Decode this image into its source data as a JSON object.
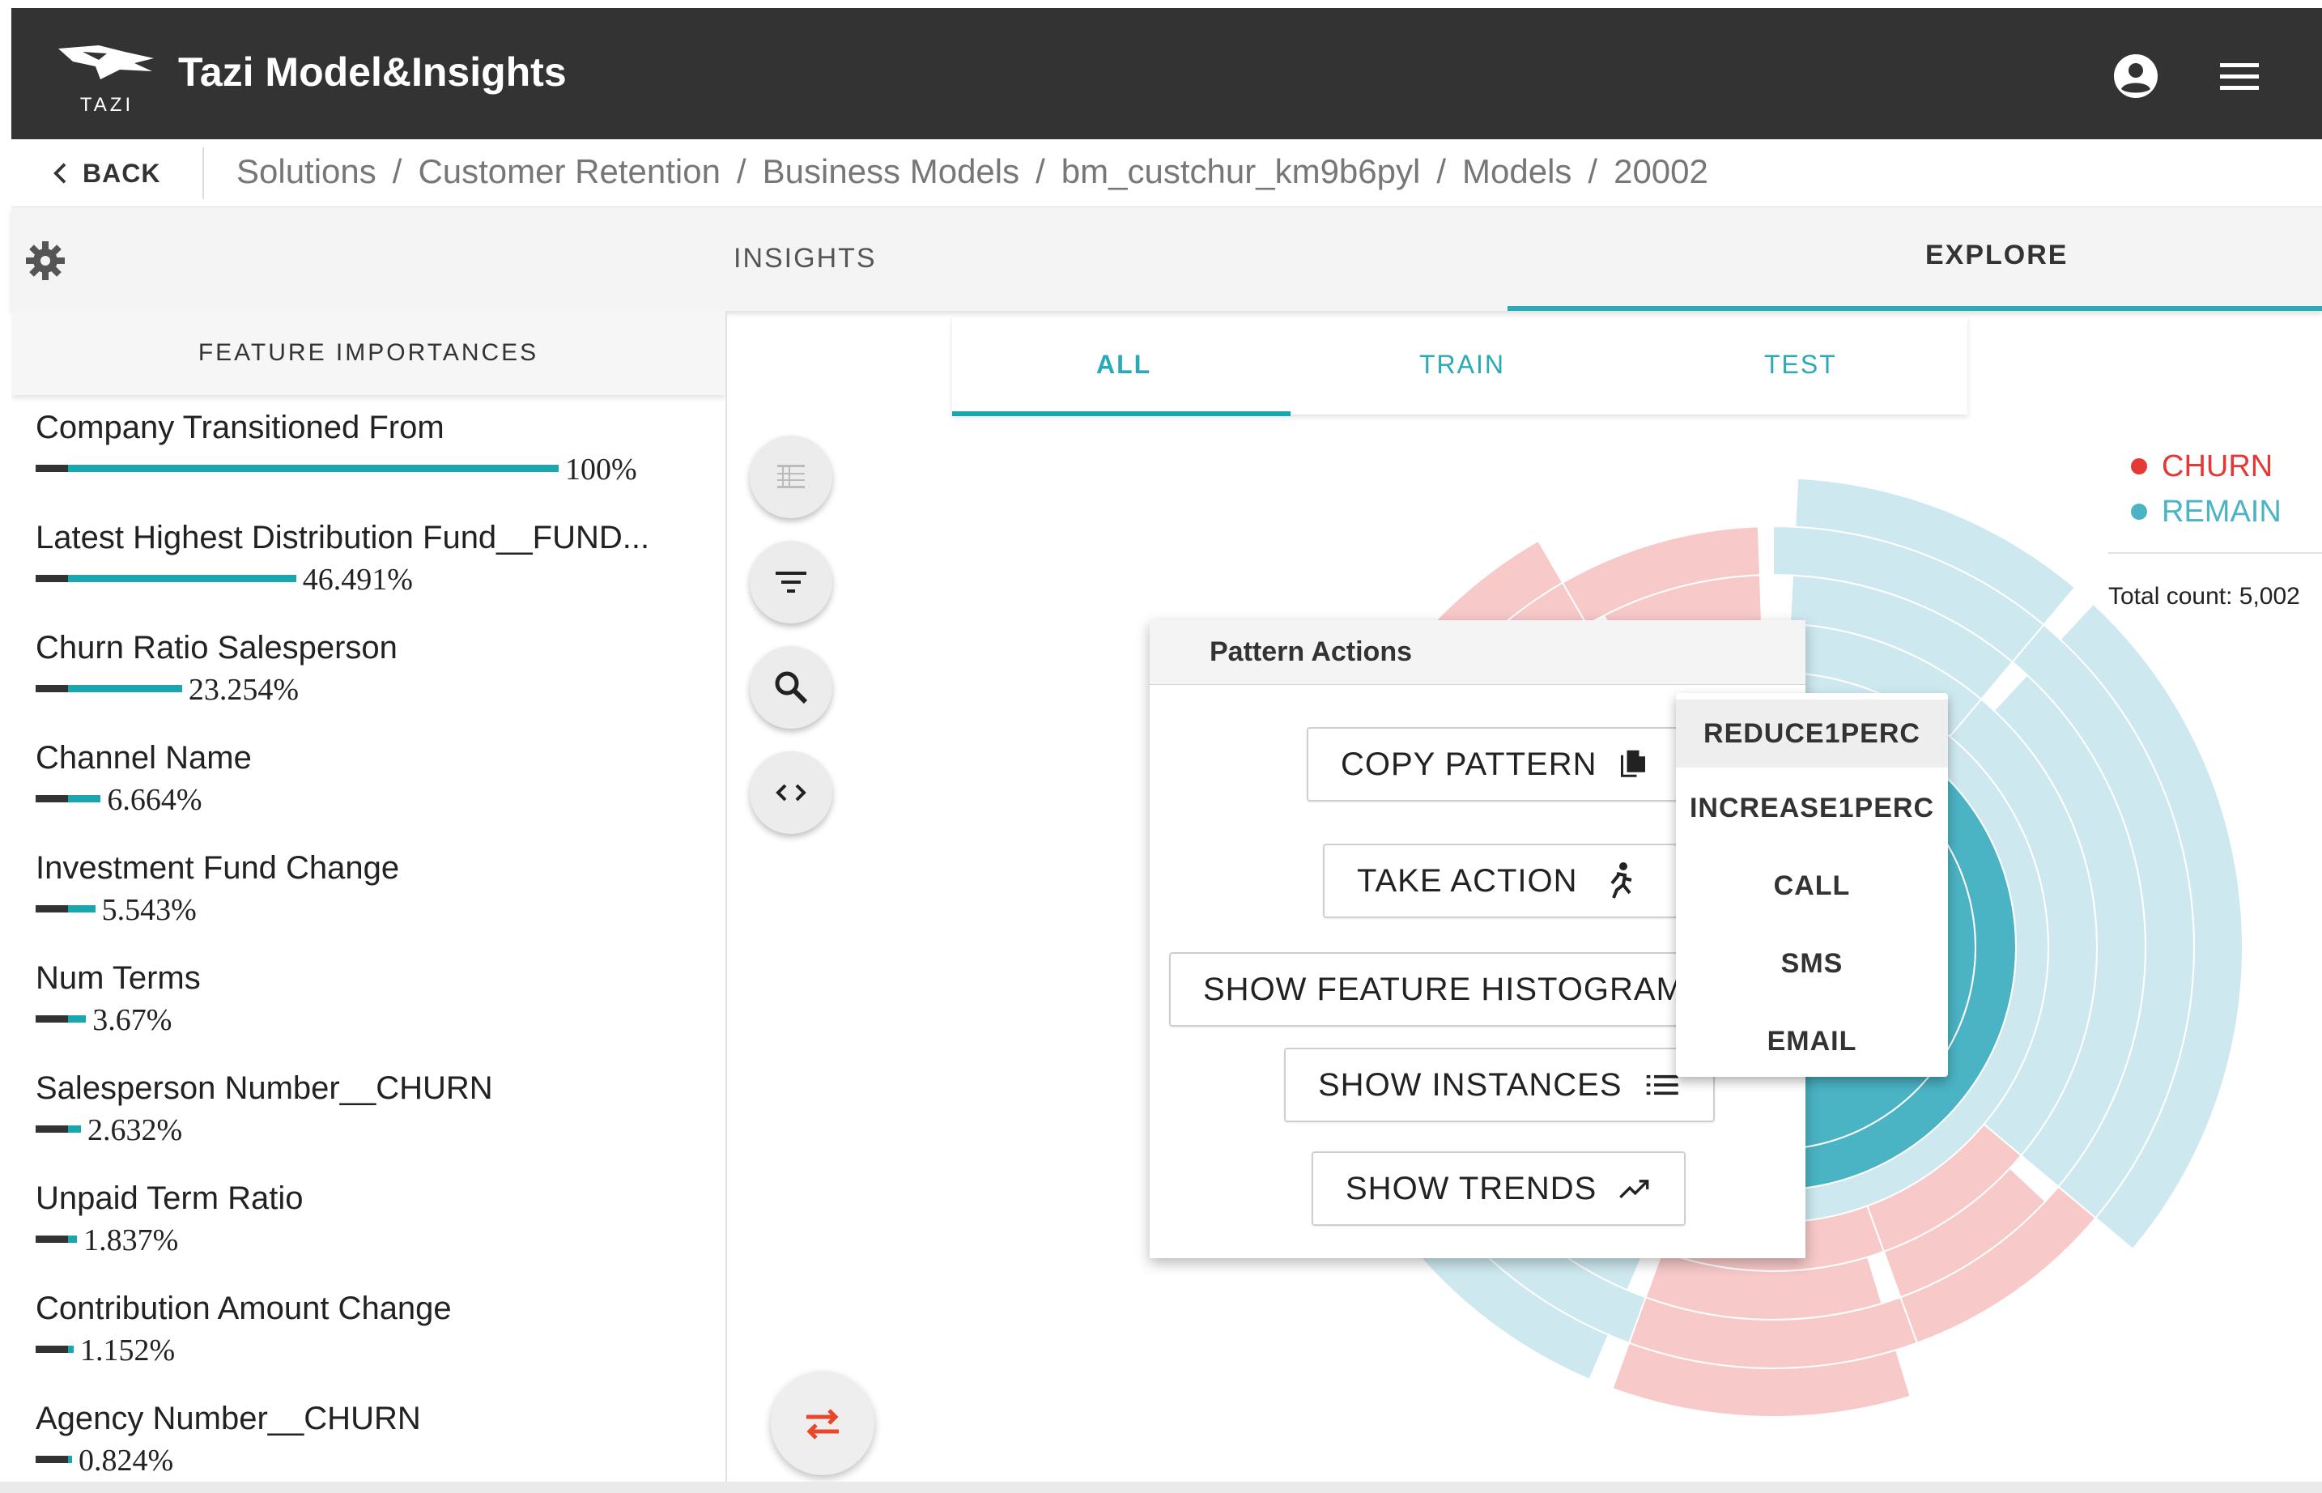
{
  "app": {
    "logo_text": "TAZI",
    "title": "Tazi Model&Insights"
  },
  "breadcrumb": {
    "back_label": "BACK",
    "items": [
      "Solutions",
      "Customer Retention",
      "Business Models",
      "bm_custchur_km9b6pyl",
      "Models",
      "20002"
    ],
    "separator": "/"
  },
  "tabs": {
    "insights": "INSIGHTS",
    "explore": "EXPLORE"
  },
  "feature_importances": {
    "header": "FEATURE IMPORTANCES",
    "items": [
      {
        "label": "Company Transitioned From",
        "value": "100%",
        "fraction": 1.0
      },
      {
        "label": "Latest Highest Distribution Fund__FUND...",
        "value": "46.491%",
        "fraction": 0.46491
      },
      {
        "label": "Churn Ratio Salesperson",
        "value": "23.254%",
        "fraction": 0.23254
      },
      {
        "label": "Channel Name",
        "value": "6.664%",
        "fraction": 0.06664
      },
      {
        "label": "Investment Fund Change",
        "value": "5.543%",
        "fraction": 0.05543
      },
      {
        "label": "Num Terms",
        "value": "3.67%",
        "fraction": 0.0367
      },
      {
        "label": "Salesperson Number__CHURN",
        "value": "2.632%",
        "fraction": 0.02632
      },
      {
        "label": "Unpaid Term Ratio",
        "value": "1.837%",
        "fraction": 0.01837
      },
      {
        "label": "Contribution Amount Change",
        "value": "1.152%",
        "fraction": 0.01152
      },
      {
        "label": "Agency Number__CHURN",
        "value": "0.824%",
        "fraction": 0.00824
      }
    ]
  },
  "subtabs": {
    "all": "ALL",
    "train": "TRAIN",
    "test": "TEST",
    "active": "ALL"
  },
  "legend": {
    "churn_label": "CHURN",
    "remain_label": "REMAIN",
    "churn_color": "#e53935",
    "remain_color": "#4ab3c4"
  },
  "total_count": "Total count: 5,002",
  "pattern_actions": {
    "title": "Pattern Actions",
    "copy_pattern": "COPY PATTERN",
    "take_action": "TAKE ACTION",
    "show_feature_histograms": "SHOW FEATURE HISTOGRAMS",
    "show_instances": "SHOW INSTANCES",
    "show_trends": "SHOW TRENDS"
  },
  "action_menu": {
    "items": [
      "REDUCE1PERC",
      "INCREASE1PERC",
      "CALL",
      "SMS",
      "EMAIL"
    ],
    "highlighted": "REDUCE1PERC"
  },
  "icons": {
    "account": "account-circle-icon",
    "menu": "hamburger-menu-icon",
    "back": "chevron-left-icon",
    "settings": "gear-icon",
    "table": "table-icon",
    "filter": "filter-icon",
    "search": "search-icon",
    "code": "code-icon",
    "copy": "copy-icon",
    "run": "run-icon",
    "list": "list-icon",
    "trend": "trending-up-icon",
    "swap": "swap-icon"
  },
  "colors": {
    "accent": "#19a6b1",
    "appbar": "#333333",
    "swap_icon": "#e8472a"
  }
}
